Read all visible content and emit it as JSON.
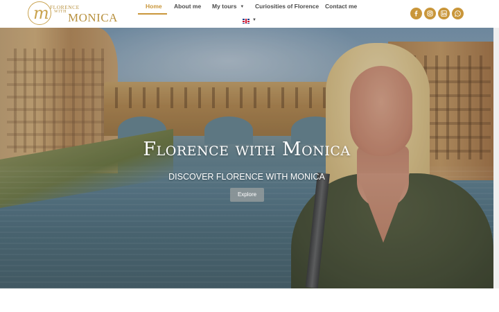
{
  "brand": {
    "logo_mark": "m",
    "line1": "Florence",
    "line2": "with",
    "line3": "Monica"
  },
  "nav": {
    "items": [
      {
        "label": "Home",
        "active": true
      },
      {
        "label": "About me",
        "active": false
      },
      {
        "label": "My tours",
        "active": false,
        "has_dropdown": true
      },
      {
        "label": "Curiosities of Florence",
        "active": false
      },
      {
        "label": "Contact me",
        "active": false
      }
    ],
    "language": {
      "flag": "uk-flag-icon"
    }
  },
  "socials": [
    "facebook-icon",
    "instagram-icon",
    "linkedin-icon",
    "whatsapp-icon"
  ],
  "hero": {
    "title": "Florence with Monica",
    "subtitle": "DISCOVER FLORENCE WITH MONICA",
    "button_label": "Explore"
  },
  "colors": {
    "accent": "#c9963a",
    "nav_text": "#4a4a4a",
    "hero_text": "#ffffff"
  }
}
